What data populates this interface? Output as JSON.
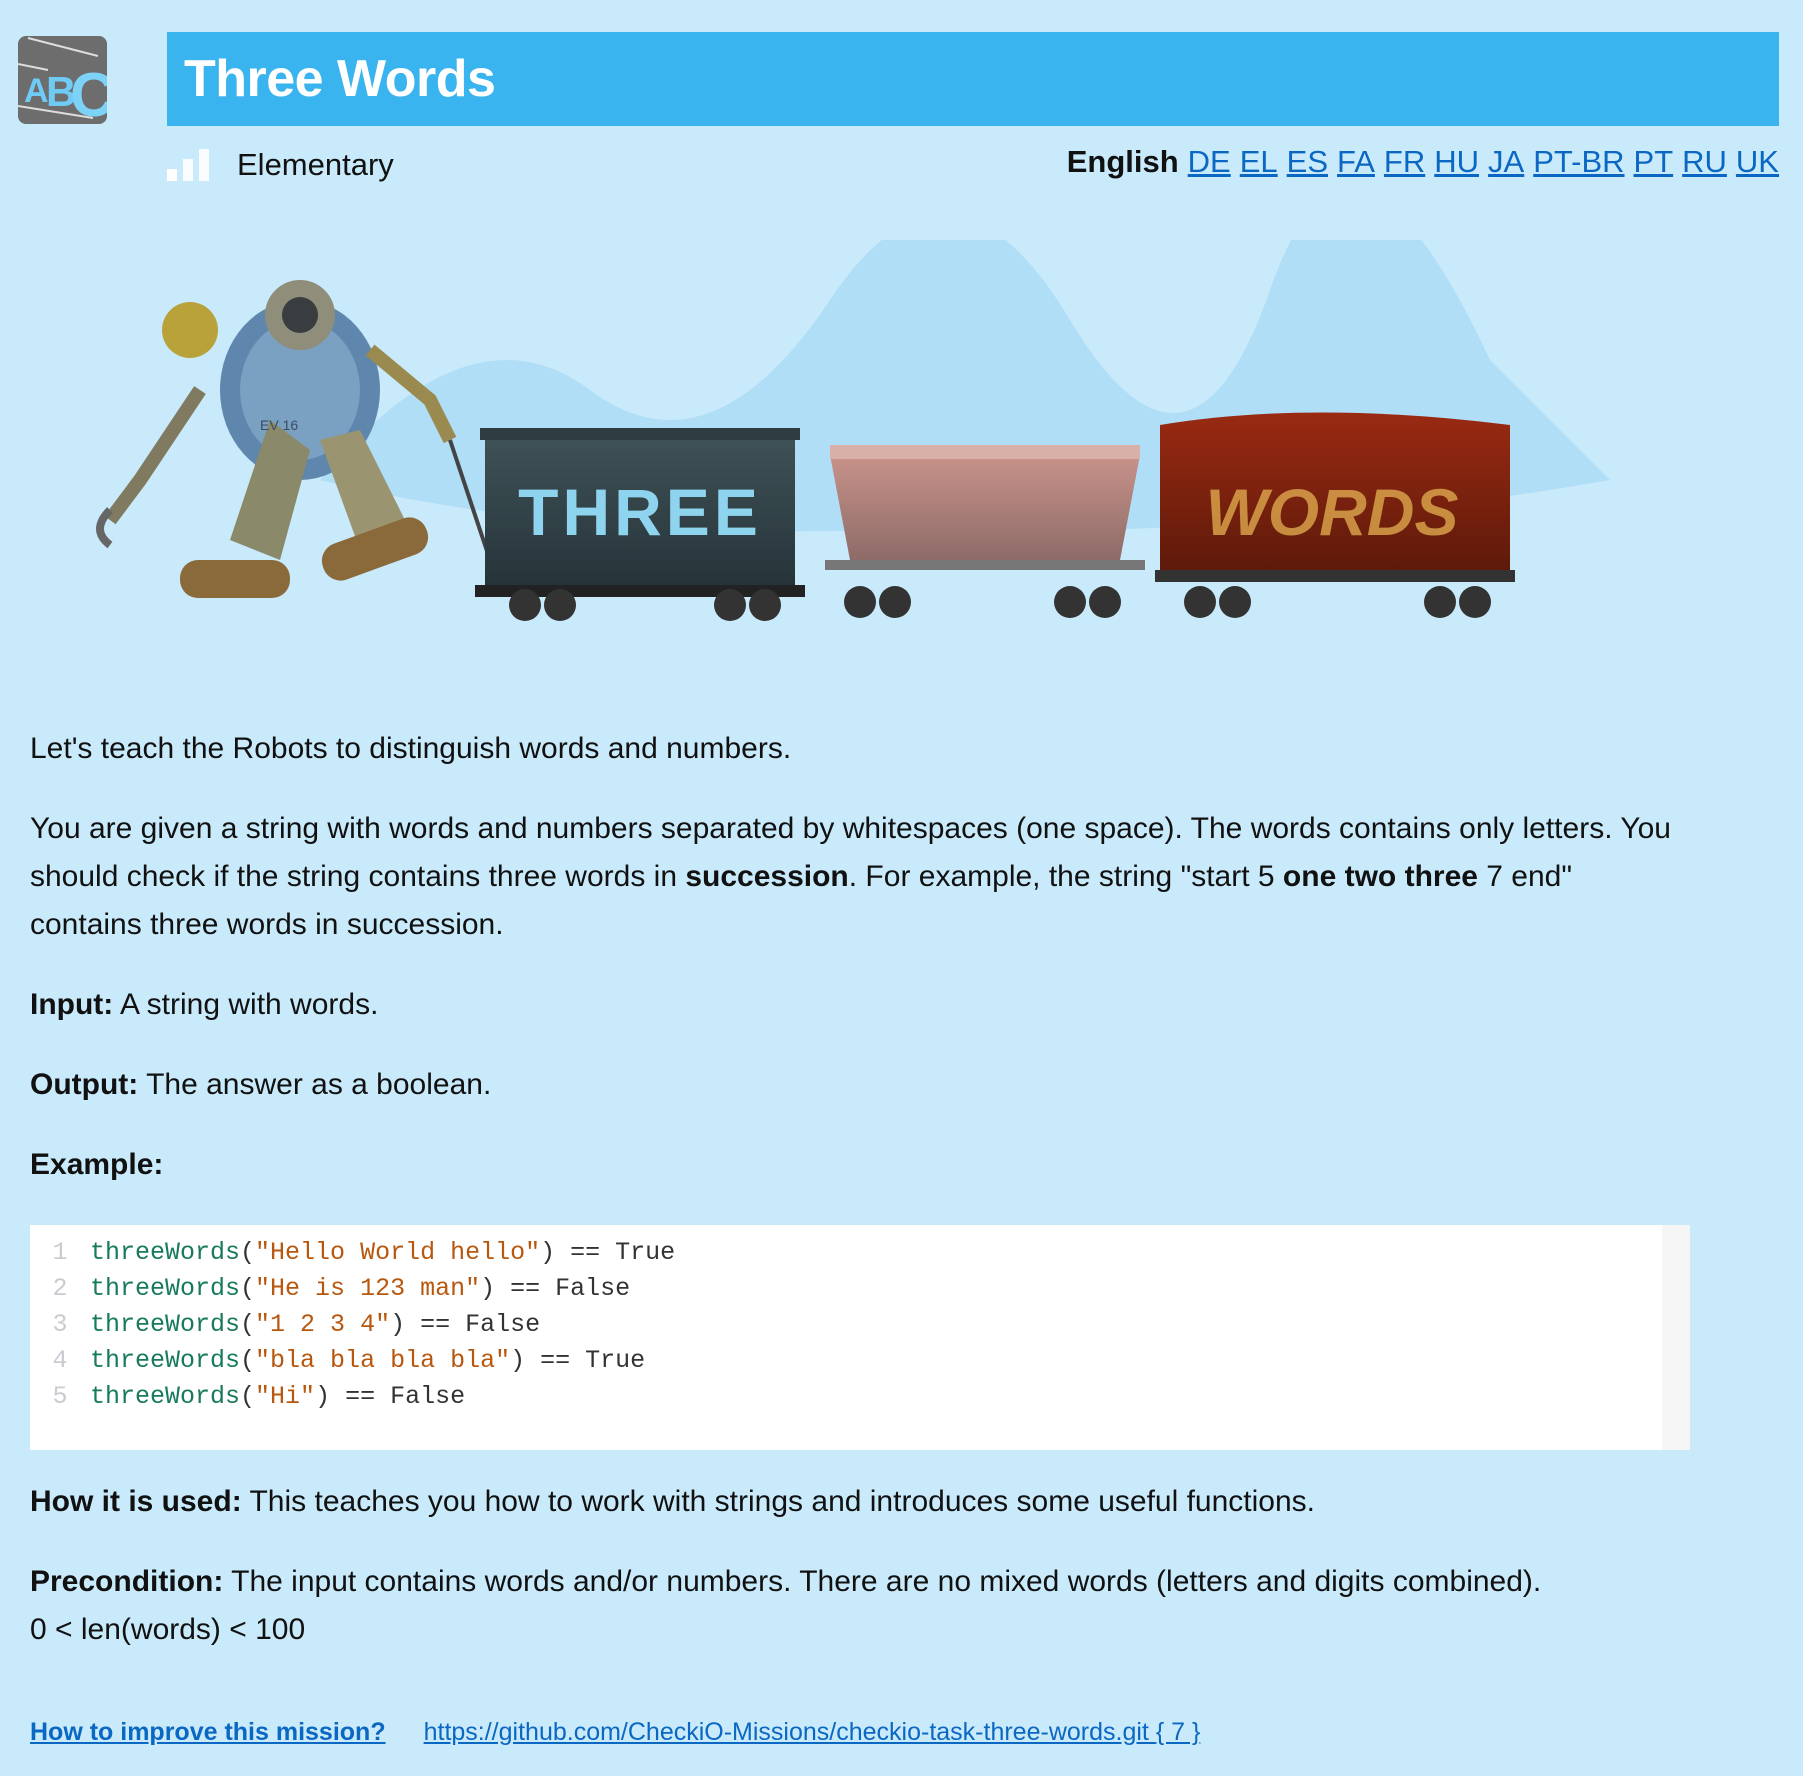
{
  "header": {
    "title": "Three Words",
    "logo_text": "ABC",
    "difficulty": "Elementary",
    "difficulty_level": 1
  },
  "languages": {
    "current": "English",
    "links": [
      "DE",
      "EL",
      "ES",
      "FA",
      "FR",
      "HU",
      "JA",
      "PT-BR",
      "PT",
      "RU",
      "UK"
    ]
  },
  "hero": {
    "wagon1_text": "THREE",
    "wagon3_text": "WORDS",
    "robot_label": "EV 16"
  },
  "description": {
    "intro": "Let's teach the Robots to distinguish words and numbers.",
    "p2_a": "You are given a string with words and numbers separated by whitespaces (one space). The words contains only letters. You should check if the string contains three words in ",
    "p2_b": "succession",
    "p2_c": ". For example, the string \"start 5 ",
    "p2_d": "one two three",
    "p2_e": " 7 end\" contains three words in succession.",
    "input_label": "Input:",
    "input_text": " A string with words.",
    "output_label": "Output:",
    "output_text": " The answer as a boolean.",
    "example_label": "Example:"
  },
  "code": [
    {
      "n": "1",
      "fn": "threeWords",
      "arg": "\"Hello World hello\"",
      "res": "True"
    },
    {
      "n": "2",
      "fn": "threeWords",
      "arg": "\"He is 123 man\"",
      "res": "False"
    },
    {
      "n": "3",
      "fn": "threeWords",
      "arg": "\"1 2 3 4\"",
      "res": "False"
    },
    {
      "n": "4",
      "fn": "threeWords",
      "arg": "\"bla bla bla bla\"",
      "res": "True"
    },
    {
      "n": "5",
      "fn": "threeWords",
      "arg": "\"Hi\"",
      "res": "False"
    }
  ],
  "usage": {
    "label": "How it is used:",
    "text": " This teaches you how to work with strings and introduces some useful functions."
  },
  "precondition": {
    "label": "Precondition:",
    "text": " The input contains words and/or numbers. There are no mixed words (letters and digits combined).",
    "line2": "0 < len(words) < 100"
  },
  "footer": {
    "improve": "How to improve this mission?",
    "repo": "https://github.com/CheckiO-Missions/checkio-task-three-words.git",
    "count": "{ 7 }"
  },
  "colors": {
    "background": "#c9eafb",
    "title_bar": "#3ab4ee",
    "link": "#0a67c2",
    "code_fn": "#177a5d",
    "code_str": "#b8570e"
  }
}
